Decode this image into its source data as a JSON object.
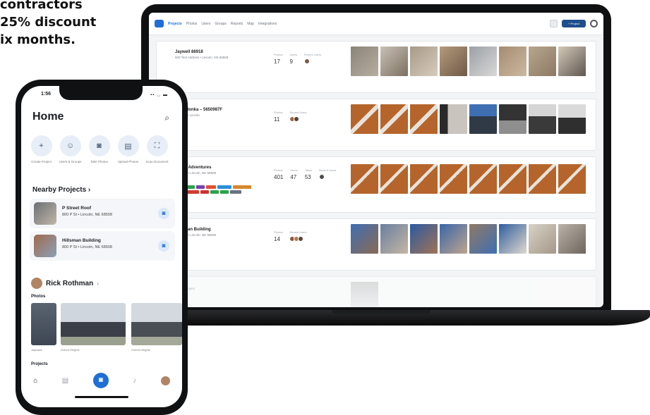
{
  "promo": {
    "line1": "contractors",
    "line2": "25% discount",
    "line3": "ix months."
  },
  "phone": {
    "status_time": "1:56",
    "status_icons": "▪▪ ◡ ▬",
    "title": "Home",
    "actions": [
      {
        "icon": "pin-icon",
        "label": "Create Project"
      },
      {
        "icon": "people-icon",
        "label": "Users & Groups"
      },
      {
        "icon": "camera-icon",
        "label": "Take Photos"
      },
      {
        "icon": "document-icon",
        "label": "Upload Photos"
      },
      {
        "icon": "scan-icon",
        "label": "Scan Document"
      }
    ],
    "nearby_title": "Nearby Projects",
    "nearby": [
      {
        "name": "P Street Roof",
        "address": "800 P St • Lincoln, NE 68508"
      },
      {
        "name": "Hillsman Building",
        "address": "800 P St • Lincoln, NE 68508"
      }
    ],
    "user_name": "Rick Rothman",
    "photos_title": "Photos",
    "photo_labels": [
      "Jayhawk",
      "Oxford Heights",
      "Oxford Heights"
    ],
    "projects_title": "Projects"
  },
  "laptop": {
    "nav": [
      "Projects",
      "Photos",
      "Users",
      "Groups",
      "Reports",
      "Map",
      "Integrations"
    ],
    "new_button": "+ Project",
    "projects": [
      {
        "name": "Jaywell 88918",
        "address": "800 Test Address • Lincoln, NE 68508",
        "photos": "17",
        "users": "9"
      },
      {
        "name": "Minnetonka – 5650987F",
        "address": "Address • Lincoln",
        "photos": "11",
        "users": ""
      },
      {
        "name": "South Adventures",
        "address": "800 P St • Lincoln, NE 68508",
        "photos": "401",
        "users": "47",
        "tasks": "53"
      },
      {
        "name": "Hillsman Building",
        "address": "800 P St • Lincoln, NE 68508",
        "photos": "14",
        "users": ""
      },
      {
        "name": "Empty Project",
        "address": "",
        "photos": "",
        "users": ""
      }
    ]
  },
  "colors": {
    "accent": "#1f6fd6",
    "wood": "#b5652b",
    "sky": "#3f6fb3"
  }
}
